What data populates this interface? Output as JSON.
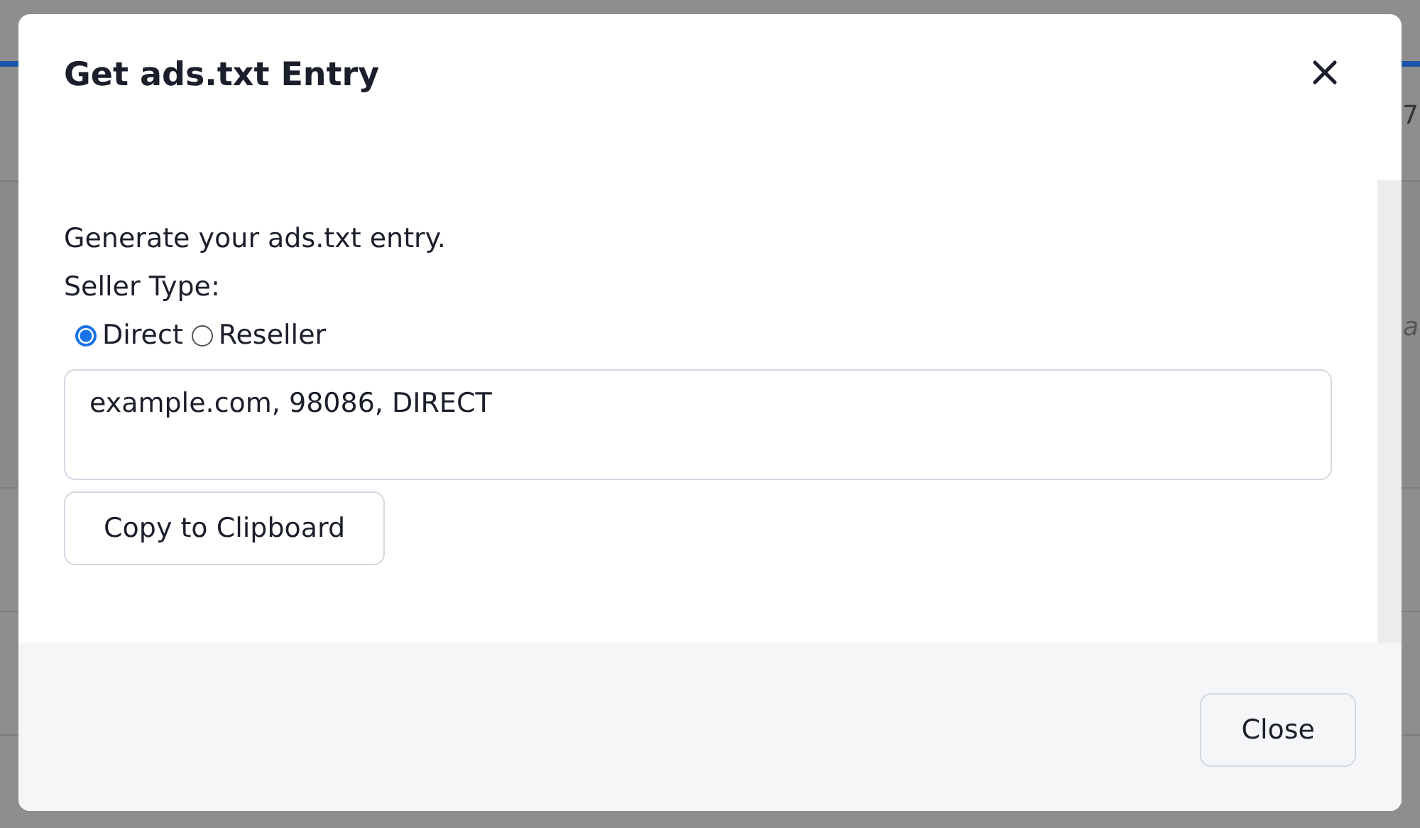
{
  "background": {
    "fragments": [
      "7",
      "a"
    ]
  },
  "dialog": {
    "title": "Get ads.txt Entry",
    "intro": "Generate your ads.txt entry.",
    "seller_type_label": "Seller Type:",
    "seller_types": [
      {
        "label": "Direct",
        "selected": true
      },
      {
        "label": "Reseller",
        "selected": false
      }
    ],
    "entry_value": "example.com, 98086, DIRECT",
    "copy_button": "Copy to Clipboard",
    "close_button": "Close"
  }
}
